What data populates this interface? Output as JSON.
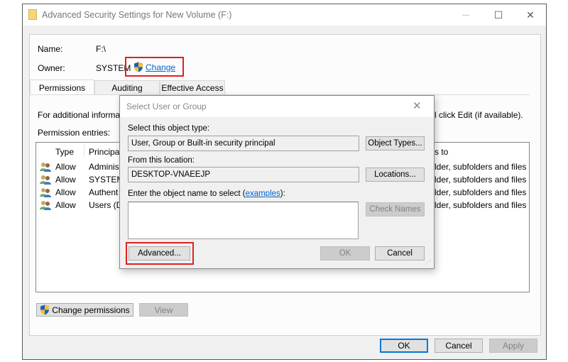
{
  "window": {
    "title": "Advanced Security Settings for New Volume (F:)",
    "controls": {
      "minimize": "—",
      "maximize": "☐",
      "close": "✕"
    }
  },
  "info": {
    "name_label": "Name:",
    "name_value": "F:\\",
    "owner_label": "Owner:",
    "owner_value": "SYSTEM",
    "change_link": "Change"
  },
  "tabs": [
    {
      "label": "Permissions",
      "active": true
    },
    {
      "label": "Auditing",
      "active": false
    },
    {
      "label": "Effective Access",
      "active": false
    }
  ],
  "permissions": {
    "info_text_left": "For additional informat",
    "info_text_right": "l click Edit (if available).",
    "entries_label": "Permission entries:",
    "columns": {
      "type": "Type",
      "principal": "Principa",
      "applies": "s to"
    },
    "rows": [
      {
        "type": "Allow",
        "principal": "Adminis",
        "applies": "lder, subfolders and files"
      },
      {
        "type": "Allow",
        "principal": "SYSTEM",
        "applies": "lder, subfolders and files"
      },
      {
        "type": "Allow",
        "principal": "Authent",
        "applies": "lder, subfolders and files"
      },
      {
        "type": "Allow",
        "principal": "Users (D",
        "applies": "lder, subfolders and files"
      }
    ],
    "change_permissions_button": "Change permissions",
    "view_button": "View"
  },
  "footer": {
    "ok": "OK",
    "cancel": "Cancel",
    "apply": "Apply"
  },
  "dialog": {
    "title": "Select User or Group",
    "close": "✕",
    "object_type_label": "Select this object type:",
    "object_type_value": "User, Group or Built-in security principal",
    "object_types_button": "Object Types...",
    "location_label": "From this location:",
    "location_value": "DESKTOP-VNAEEJP",
    "locations_button": "Locations...",
    "enter_label_prefix": "Enter the object name to select (",
    "examples_link": "examples",
    "enter_label_suffix": "):",
    "object_name_value": "",
    "check_names_button": "Check Names",
    "advanced_button": "Advanced...",
    "ok_button": "OK",
    "cancel_button": "Cancel"
  },
  "colors": {
    "highlight": "#e02020",
    "link": "#0066cc",
    "default_button": "#0078d7"
  }
}
